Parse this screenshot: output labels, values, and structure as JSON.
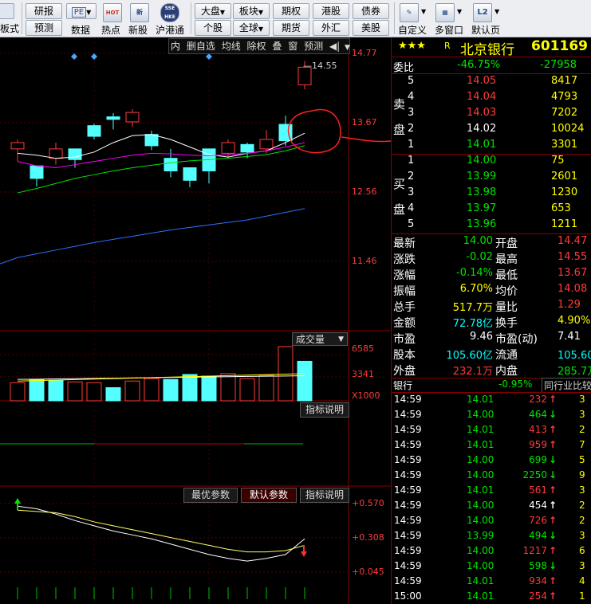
{
  "toolbar": {
    "left_label": "板式",
    "buttons": [
      {
        "top": "研报",
        "bottom": "预测"
      },
      {
        "top": "PE",
        "bottom": "数据"
      }
    ],
    "icons": [
      {
        "name": "hot-icon",
        "glyph": "HOT",
        "label": "热点"
      },
      {
        "name": "new-stock-icon",
        "glyph": "新",
        "label": "新股"
      },
      {
        "name": "hk-connect-icon",
        "glyph": "SSE HKE",
        "label": "沪港通"
      }
    ],
    "market_buttons": [
      {
        "top": "大盘",
        "bottom": "个股"
      },
      {
        "top": "板块",
        "bottom": "全球"
      },
      {
        "top": "期权",
        "bottom": "期货"
      },
      {
        "top": "港股",
        "bottom": "外汇"
      },
      {
        "top": "债券",
        "bottom": "美股"
      }
    ],
    "right_icons": [
      {
        "name": "custom-icon",
        "label": "自定义"
      },
      {
        "name": "multi-window-icon",
        "label": "多窗口"
      },
      {
        "name": "l2-icon",
        "glyph": "L2",
        "label": "默认页"
      }
    ]
  },
  "chart_toolbar": [
    "内",
    "删自选",
    "均线",
    "除权",
    "叠",
    "窗",
    "预测"
  ],
  "price_axis": [
    "14.77",
    "13.67",
    "12.56",
    "11.46"
  ],
  "last_price_label": "14.55",
  "volume_panel": {
    "title": "成交量",
    "axis": [
      "6585",
      "3341",
      "X1000"
    ],
    "help": "指标说明"
  },
  "indicator_panel": {
    "tabs": [
      "最优参数",
      "默认参数",
      "指标说明"
    ],
    "axis": [
      "+0.570",
      "+0.308",
      "+0.045"
    ]
  },
  "chart_data": {
    "type": "candlestick",
    "x": [
      1,
      2,
      3,
      4,
      5,
      6,
      7,
      8,
      9,
      10,
      11,
      12,
      13,
      14,
      15,
      16
    ],
    "open": [
      13.25,
      12.98,
      13.1,
      13.25,
      13.62,
      13.76,
      13.68,
      13.48,
      13.1,
      12.95,
      13.25,
      13.18,
      13.32,
      13.25,
      13.64,
      14.27
    ],
    "close": [
      13.35,
      12.78,
      13.25,
      13.08,
      13.45,
      13.72,
      13.83,
      13.3,
      12.9,
      12.75,
      12.9,
      13.35,
      13.2,
      13.4,
      13.38,
      14.55
    ],
    "high": [
      13.4,
      12.95,
      13.35,
      13.2,
      13.65,
      13.82,
      13.88,
      13.54,
      13.25,
      12.95,
      13.25,
      13.4,
      13.35,
      13.55,
      13.78,
      14.65
    ],
    "low": [
      13.05,
      12.65,
      13.0,
      12.95,
      13.4,
      13.56,
      13.6,
      13.23,
      12.8,
      12.64,
      12.7,
      13.1,
      13.1,
      13.18,
      13.3,
      14.2
    ],
    "ylim": [
      11.0,
      14.9
    ],
    "ma_short": [
      13.18,
      13.15,
      13.1,
      13.12,
      13.2,
      13.35,
      13.46,
      13.48,
      13.4,
      13.28,
      13.16,
      13.12,
      13.18,
      13.22,
      13.35,
      13.5
    ],
    "ma_mid": [
      13.05,
      12.98,
      12.95,
      13.0,
      13.05,
      13.1,
      13.15,
      13.18,
      13.17,
      13.15,
      13.14,
      13.16,
      13.18,
      13.22,
      13.28,
      13.35
    ],
    "ma_long": [
      12.55,
      12.62,
      12.7,
      12.78,
      12.84,
      12.9,
      12.95,
      12.99,
      13.03,
      13.06,
      13.08,
      13.1,
      13.13,
      13.16,
      13.22,
      13.3
    ],
    "ma_120": [
      11.52,
      11.58,
      11.64,
      11.7,
      11.76,
      11.81,
      11.86,
      11.91,
      11.96,
      12.0,
      12.04,
      12.08,
      12.12,
      12.18,
      12.24,
      12.3
    ],
    "volume": [
      2200,
      2600,
      2500,
      2300,
      2200,
      1600,
      2400,
      2700,
      2600,
      3200,
      3000,
      3300,
      2700,
      3100,
      6585,
      4800
    ],
    "volume_colors": [
      "up",
      "down",
      "down",
      "up",
      "up",
      "down",
      "up",
      "up",
      "down",
      "down",
      "down",
      "up",
      "up",
      "up",
      "up",
      "down"
    ],
    "indicator": [
      0.55,
      0.53,
      0.49,
      0.44,
      0.4,
      0.36,
      0.33,
      0.3,
      0.26,
      0.22,
      0.18,
      0.15,
      0.13,
      0.15,
      0.18,
      0.3
    ],
    "indicator_signal": [
      0.52,
      0.51,
      0.5,
      0.47,
      0.43,
      0.4,
      0.37,
      0.34,
      0.31,
      0.28,
      0.25,
      0.22,
      0.2,
      0.2,
      0.21,
      0.25
    ]
  },
  "quote": {
    "stars": "★★★",
    "r_badge": "R",
    "name": "北京银行",
    "code": "601169",
    "weibi_label": "委比",
    "weibi_value": "-46.75%",
    "weicha_value": "-27958",
    "sell_label": "卖盘",
    "buy_label": "买盘",
    "sell": [
      {
        "level": "5",
        "price": "14.05",
        "vol": "8417"
      },
      {
        "level": "4",
        "price": "14.04",
        "vol": "4793"
      },
      {
        "level": "3",
        "price": "14.03",
        "vol": "7202"
      },
      {
        "level": "2",
        "price": "14.02",
        "vol": "10024"
      },
      {
        "level": "1",
        "price": "14.01",
        "vol": "3301"
      }
    ],
    "buy": [
      {
        "level": "1",
        "price": "14.00",
        "vol": "75"
      },
      {
        "level": "2",
        "price": "13.99",
        "vol": "2601"
      },
      {
        "level": "3",
        "price": "13.98",
        "vol": "1230"
      },
      {
        "level": "4",
        "price": "13.97",
        "vol": "653"
      },
      {
        "level": "5",
        "price": "13.96",
        "vol": "1211"
      }
    ],
    "stats": [
      {
        "l1": "最新",
        "v1": "14.00",
        "l2": "开盘",
        "v2": "14.47"
      },
      {
        "l1": "涨跌",
        "v1": "-0.02",
        "l2": "最高",
        "v2": "14.55"
      },
      {
        "l1": "涨幅",
        "v1": "-0.14%",
        "l2": "最低",
        "v2": "13.67"
      },
      {
        "l1": "振幅",
        "v1": "6.70%",
        "l2": "均价",
        "v2": "14.08"
      },
      {
        "l1": "总手",
        "v1": "517.7万",
        "l2": "量比",
        "v2": "1.29"
      },
      {
        "l1": "金额",
        "v1": "72.78亿",
        "l2": "换手",
        "v2": "4.90%"
      },
      {
        "l1": "市盈",
        "v1": "9.46",
        "l2": "市盈(动)",
        "v2": "7.41"
      },
      {
        "l1": "股本",
        "v1": "105.60亿",
        "l2": "流通",
        "v2": "105.60亿"
      },
      {
        "l1": "外盘",
        "v1": "232.1万",
        "l2": "内盘",
        "v2": "285.7万"
      }
    ],
    "sector_name": "银行",
    "sector_change": "-0.95%",
    "sector_btn": "同行业比较"
  },
  "ticks": [
    {
      "time": "14:59",
      "price": "14.01",
      "vol": "232",
      "dir": "up",
      "tail": "3"
    },
    {
      "time": "14:59",
      "price": "14.00",
      "vol": "464",
      "dir": "down",
      "tail": "3"
    },
    {
      "time": "14:59",
      "price": "14.01",
      "vol": "413",
      "dir": "up",
      "tail": "2"
    },
    {
      "time": "14:59",
      "price": "14.01",
      "vol": "959",
      "dir": "up",
      "tail": "7"
    },
    {
      "time": "14:59",
      "price": "14.00",
      "vol": "699",
      "dir": "down",
      "tail": "5"
    },
    {
      "time": "14:59",
      "price": "14.00",
      "vol": "2250",
      "dir": "down",
      "tail": "9"
    },
    {
      "time": "14:59",
      "price": "14.01",
      "vol": "561",
      "dir": "up",
      "tail": "3"
    },
    {
      "time": "14:59",
      "price": "14.00",
      "vol": "454",
      "dir": "neutral",
      "tail": "2"
    },
    {
      "time": "14:59",
      "price": "14.00",
      "vol": "726",
      "dir": "up",
      "tail": "2"
    },
    {
      "time": "14:59",
      "price": "13.99",
      "vol": "494",
      "dir": "down",
      "tail": "3"
    },
    {
      "time": "14:59",
      "price": "14.00",
      "vol": "1217",
      "dir": "up",
      "tail": "6"
    },
    {
      "time": "14:59",
      "price": "14.00",
      "vol": "598",
      "dir": "down",
      "tail": "3"
    },
    {
      "time": "14:59",
      "price": "14.01",
      "vol": "934",
      "dir": "up",
      "tail": "4"
    },
    {
      "time": "15:00",
      "price": "14.01",
      "vol": "254",
      "dir": "up",
      "tail": "1"
    }
  ],
  "colors": {
    "up": "#ff3b3b",
    "down": "#54ffff",
    "green": "#00e400"
  }
}
